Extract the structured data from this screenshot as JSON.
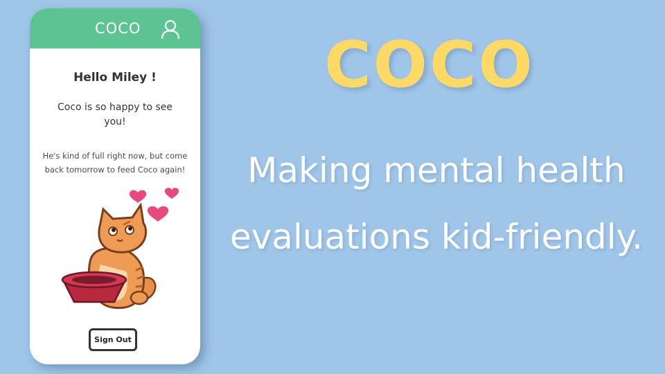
{
  "phone": {
    "app_name": "COCO",
    "greeting": "Hello Miley !",
    "happy_message": "Coco is so happy to see you!",
    "status_message": "He's kind of full right now, but come back tomorrow to feed Coco again!",
    "sign_out_label": "Sign Out",
    "header_color": "#5dc392"
  },
  "hero": {
    "title": "COCO",
    "tagline": "Making mental health evaluations kid-friendly.",
    "title_color": "#ffd966",
    "background_color": "#9fc5e8"
  },
  "icons": {
    "profile": "user-icon",
    "hearts": "heart-icon",
    "cat": "cat-illustration",
    "bowl": "food-bowl"
  }
}
